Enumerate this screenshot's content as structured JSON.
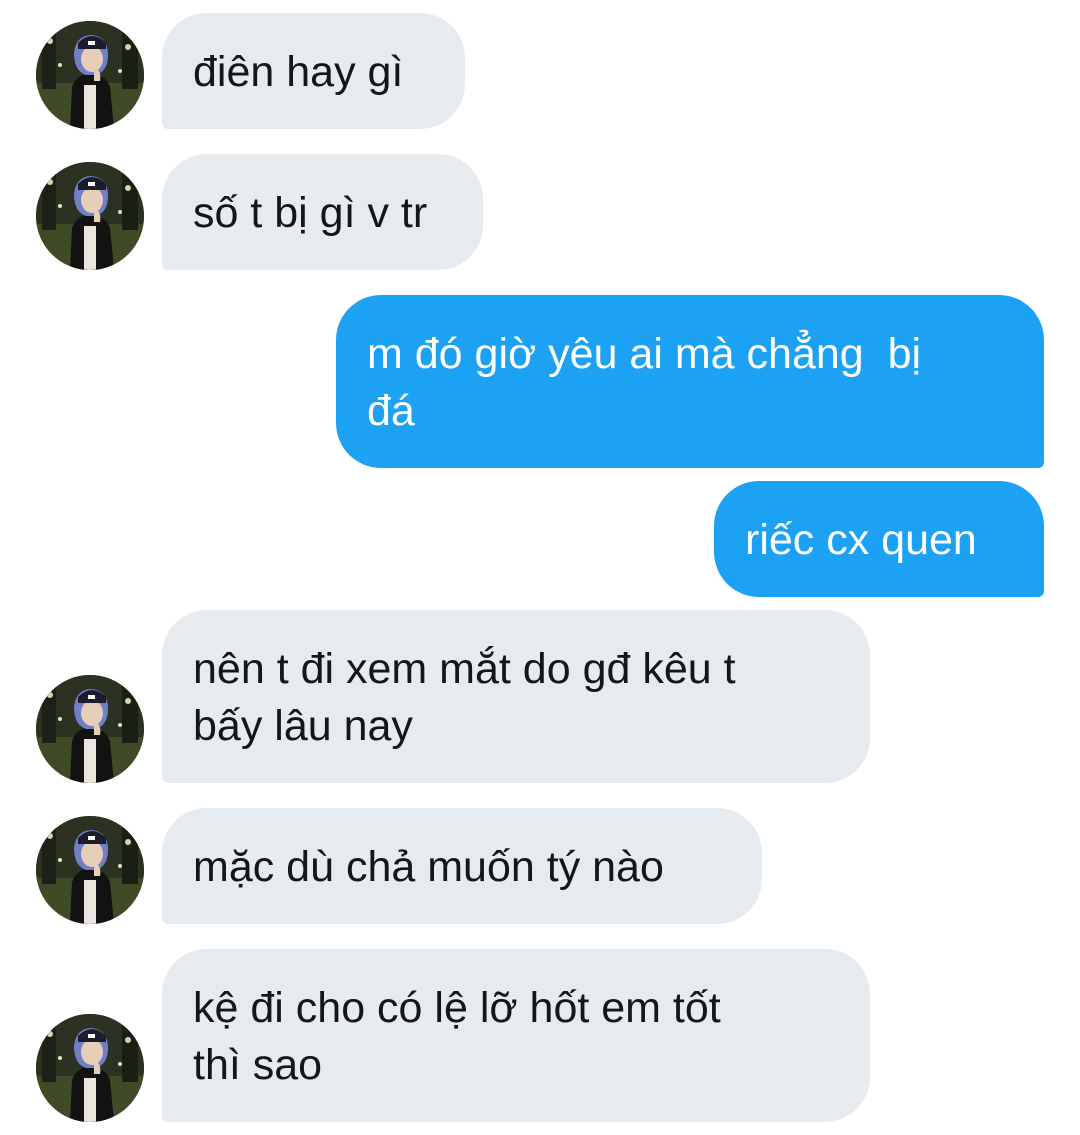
{
  "conversation": {
    "messages": [
      {
        "direction": "received",
        "text": "điên hay gì"
      },
      {
        "direction": "received",
        "text": "số t bị gì v tr"
      },
      {
        "direction": "sent",
        "text": "m đó giờ yêu ai mà chẳng  bị\nđá"
      },
      {
        "direction": "sent",
        "text": "riếc cx quen"
      },
      {
        "direction": "received",
        "text": "nên t đi xem mắt do gđ kêu t\nbấy lâu nay"
      },
      {
        "direction": "received",
        "text": "mặc dù chả muốn tý nào"
      },
      {
        "direction": "received",
        "text": "kệ đi cho có lệ lỡ hốt em tốt\nthì sao"
      }
    ]
  },
  "theme": {
    "sent_bubble_color": "#1da1f2",
    "received_bubble_color": "#e6ebef",
    "received_text_color": "#14171a",
    "sent_text_color": "#ffffff"
  },
  "icons": {
    "avatar": "contact-avatar-photo"
  }
}
